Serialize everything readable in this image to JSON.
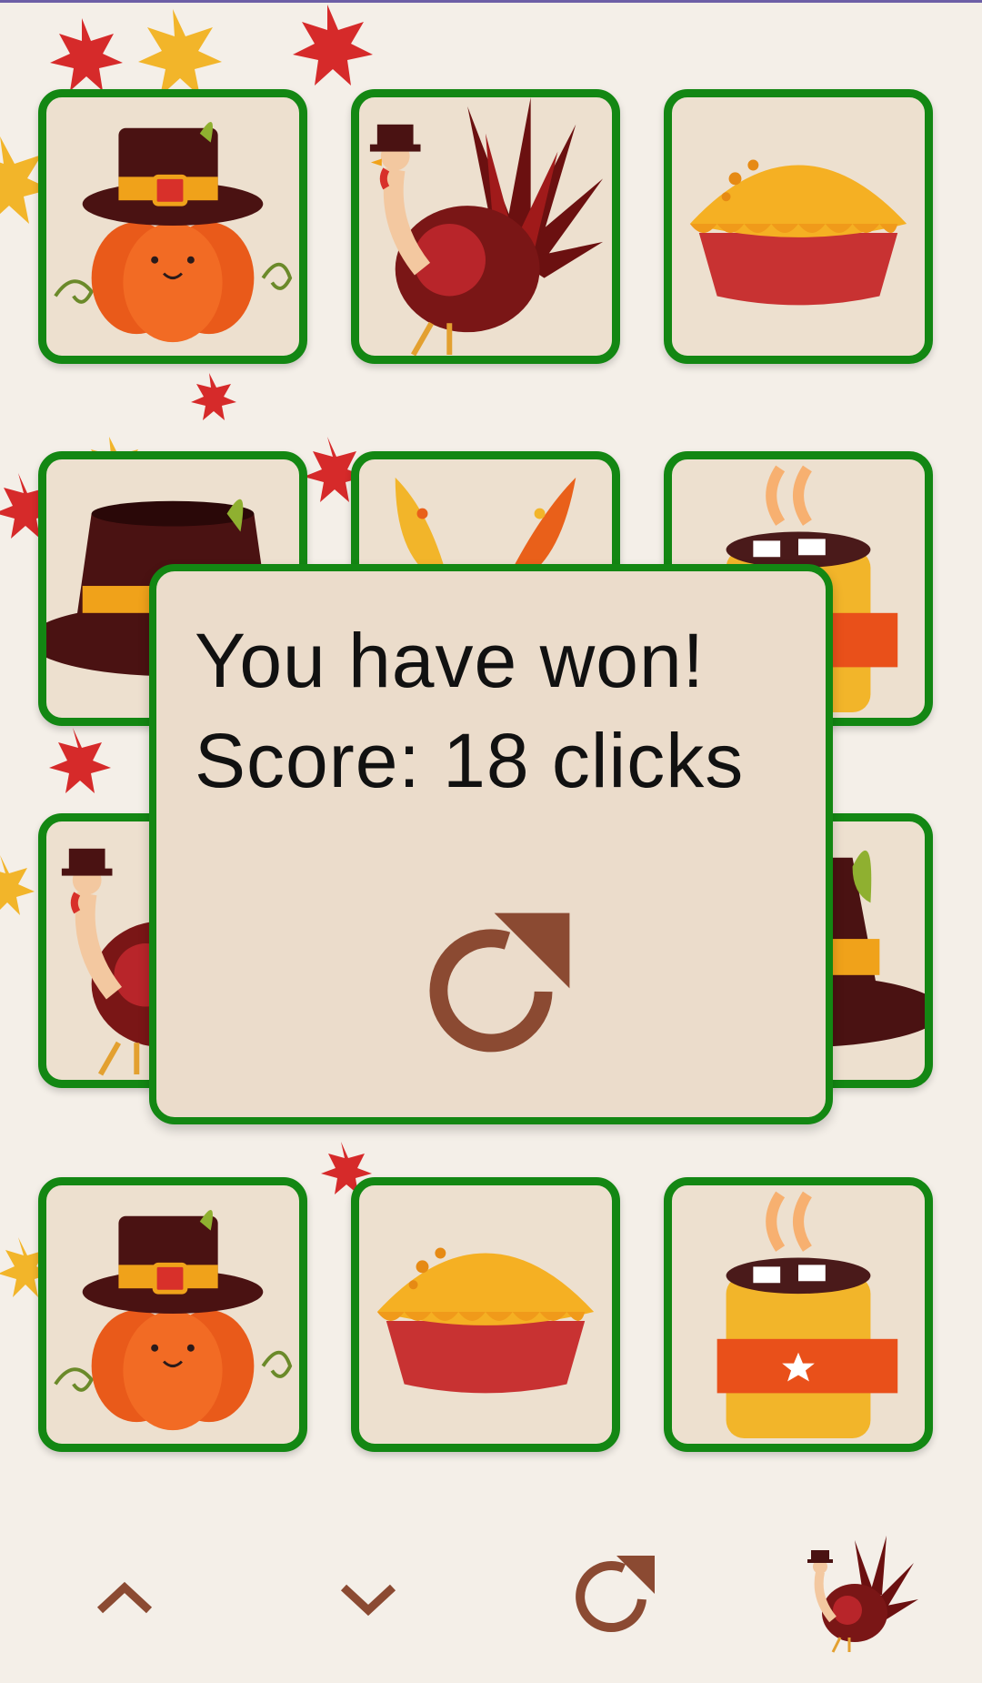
{
  "dialog": {
    "line1": "You have won!",
    "line2": "Score: 18 clicks"
  },
  "cards": [
    {
      "icon": "pumpkin-pilgrim-hat-icon"
    },
    {
      "icon": "turkey-icon"
    },
    {
      "icon": "pie-icon"
    },
    {
      "icon": "pilgrim-hat-icon"
    },
    {
      "icon": "autumn-leaves-icon"
    },
    {
      "icon": "hot-cocoa-icon"
    },
    {
      "icon": "turkey-icon"
    },
    {
      "icon": "hidden"
    },
    {
      "icon": "pilgrim-hat-icon"
    },
    {
      "icon": "pumpkin-pilgrim-hat-icon"
    },
    {
      "icon": "pie-icon"
    },
    {
      "icon": "hot-cocoa-icon"
    }
  ],
  "bottom_bar": {
    "items": [
      "chevron-up-icon",
      "chevron-down-icon",
      "refresh-icon",
      "turkey-logo-icon"
    ]
  },
  "colors": {
    "card_border": "#138713",
    "card_fill": "#ede0cf",
    "dialog_fill": "#ebdccb",
    "icon_brown": "#8b4a32",
    "background": "#f4efe8"
  }
}
